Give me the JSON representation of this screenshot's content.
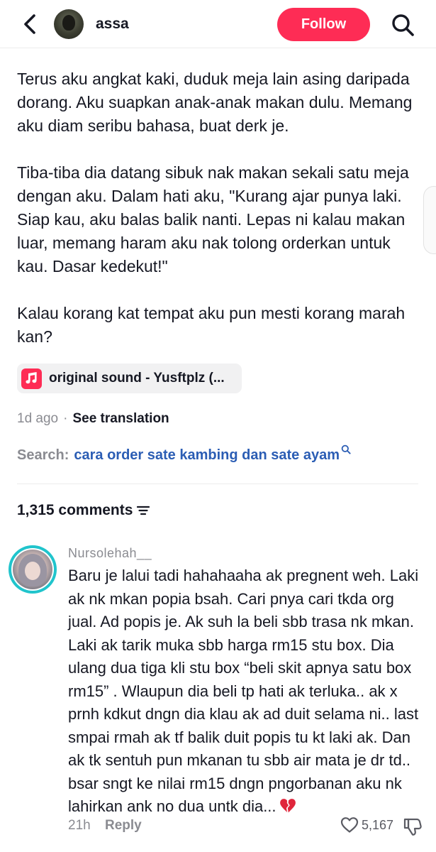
{
  "header": {
    "username": "assa",
    "follow_label": "Follow"
  },
  "caption": {
    "paragraphs": [
      "Terus aku angkat kaki, duduk meja lain asing daripada dorang. Aku suapkan anak-anak makan dulu. Memang aku diam seribu bahasa, buat derk je.",
      "Tiba-tiba dia datang sibuk nak makan sekali satu meja dengan aku. Dalam hati aku, \"Kurang ajar punya laki. Siap kau, aku balas balik nanti. Lepas ni kalau makan luar, memang haram aku nak tolong orderkan untuk kau. Dasar kedekut!\"",
      "Kalau korang kat tempat aku pun mesti korang marah kan?"
    ]
  },
  "sound": {
    "label": "original sound - Yusftplz (..."
  },
  "meta": {
    "time": "1d ago",
    "separator": "·",
    "see_translation": "See translation"
  },
  "search": {
    "label": "Search:",
    "query": "cara order sate kambing dan sate ayam"
  },
  "comments": {
    "count_label": "1,315 comments",
    "items": [
      {
        "username": "Nursolehah__",
        "text": "Baru je lalui tadi hahahaaha ak pregnent weh. Laki ak nk mkan popia bsah. Cari pnya cari tkda org jual. Ad popis je. Ak suh la beli sbb trasa nk mkan. Laki ak tarik muka sbb harga rm15 stu box. Dia ulang dua tiga kli stu box “beli skit apnya satu box rm15” . Wlaupun dia beli tp hati ak terluka.. ak x prnh kdkut dngn dia klau ak ad duit selama ni.. last smpai rmah ak tf balik duit popis tu kt laki ak. Dan ak tk sentuh pun mkanan tu sbb air mata je dr td.. bsar sngt ke nilai rm15 dngn pngorbanan aku nk lahirkan ank no dua untk dia...",
        "time": "21h",
        "reply_label": "Reply",
        "likes": "5,167"
      }
    ]
  },
  "colors": {
    "accent": "#fe2c55",
    "link": "#2b5db4",
    "muted": "#8a8b91",
    "avatar_ring": "#20c4cc"
  },
  "icons": [
    "back-arrow-icon",
    "search-icon",
    "music-note-icon",
    "search-small-icon",
    "filter-icon",
    "broken-heart-icon",
    "heart-icon",
    "dislike-icon"
  ]
}
